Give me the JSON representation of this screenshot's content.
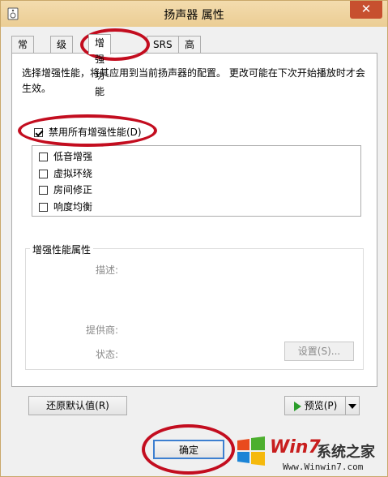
{
  "window": {
    "title": "扬声器 属性",
    "close_glyph": "✕"
  },
  "tabs": [
    "常规",
    "级别",
    "增强功能",
    "SRS",
    "高级"
  ],
  "active_tab": "增强功能",
  "description": "选择增强性能，将其应用到当前扬声器的配置。 更改可能在下次开始播放时才会生效。",
  "disable_all": {
    "label": "禁用所有增强性能(D)",
    "checked": true
  },
  "effects": [
    {
      "label": "低音增强",
      "checked": false
    },
    {
      "label": "虚拟环绕",
      "checked": false
    },
    {
      "label": "房间修正",
      "checked": false
    },
    {
      "label": "响度均衡",
      "checked": false
    }
  ],
  "properties": {
    "legend": "增强性能属性",
    "description_label": "描述:",
    "provider_label": "提供商:",
    "status_label": "状态:",
    "settings_button": "设置(S)..."
  },
  "buttons": {
    "restore_defaults": "还原默认值(R)",
    "preview": "预览(P)",
    "ok": "确定"
  },
  "watermark": {
    "brand": "Win7",
    "site": "系统之家",
    "url": "Www.Winwin7.com"
  },
  "colors": {
    "annotation_circle": "#c30d1f",
    "title_bar": "#ebcd94",
    "close_button": "#c7502f",
    "preview_play": "#2a9d2a"
  }
}
